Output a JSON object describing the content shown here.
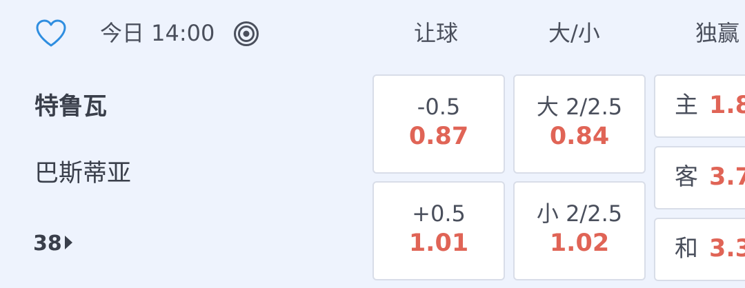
{
  "match": {
    "time": "今日 14:00",
    "favorite_icon": "heart-outline-icon",
    "live_icon": "target-icon",
    "home_team": "特鲁瓦",
    "away_team": "巴斯蒂亚",
    "more_markets_count": "38"
  },
  "columns": {
    "handicap": "让球",
    "total": "大/小",
    "one_x_two": "独赢"
  },
  "handicap": {
    "home_line": "-0.5",
    "home_price": "0.87",
    "away_line": "+0.5",
    "away_price": "1.01"
  },
  "total": {
    "over_line": "大 2/2.5",
    "over_price": "0.84",
    "under_line": "小 2/2.5",
    "under_price": "1.02"
  },
  "one_x_two": {
    "home_label": "主",
    "home_price": "1.8",
    "away_label": "客",
    "away_price": "3.7",
    "draw_label": "和",
    "draw_price": "3.3"
  },
  "colors": {
    "background": "#eef3fd",
    "price_red": "#e06456",
    "heart_blue": "#2f8ee0"
  }
}
